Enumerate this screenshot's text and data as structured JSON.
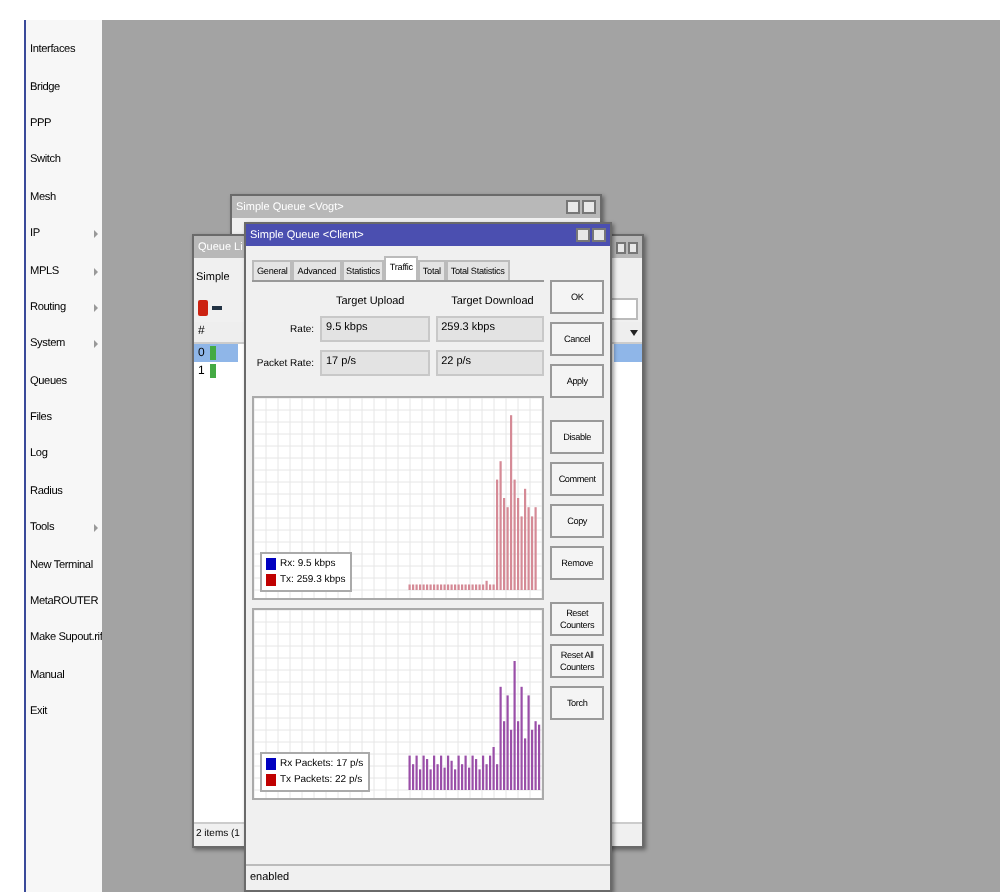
{
  "sidebar": {
    "items": [
      {
        "label": "Interfaces",
        "submenu": false
      },
      {
        "label": "Bridge",
        "submenu": false
      },
      {
        "label": "PPP",
        "submenu": false
      },
      {
        "label": "Switch",
        "submenu": false
      },
      {
        "label": "Mesh",
        "submenu": false
      },
      {
        "label": "IP",
        "submenu": true
      },
      {
        "label": "MPLS",
        "submenu": true
      },
      {
        "label": "Routing",
        "submenu": true
      },
      {
        "label": "System",
        "submenu": true
      },
      {
        "label": "Queues",
        "submenu": false
      },
      {
        "label": "Files",
        "submenu": false
      },
      {
        "label": "Log",
        "submenu": false
      },
      {
        "label": "Radius",
        "submenu": false
      },
      {
        "label": "Tools",
        "submenu": true
      },
      {
        "label": "New Terminal",
        "submenu": false
      },
      {
        "label": "MetaROUTER",
        "submenu": false
      },
      {
        "label": "Make Supout.rif",
        "submenu": false
      },
      {
        "label": "Manual",
        "submenu": false
      },
      {
        "label": "Exit",
        "submenu": false
      }
    ]
  },
  "back_window": {
    "title": "Simple Queue <Vogt>"
  },
  "list_window": {
    "title": "Queue Li",
    "tab": "Simple",
    "column": "#",
    "rows": [
      {
        "number": "0",
        "selected": true
      },
      {
        "number": "1",
        "selected": false
      }
    ],
    "status": "2 items (1"
  },
  "queue_window": {
    "title": "Simple Queue <Client>",
    "tabs": [
      {
        "label": "General",
        "selected": false
      },
      {
        "label": "Advanced",
        "selected": false
      },
      {
        "label": "Statistics",
        "selected": false
      },
      {
        "label": "Traffic",
        "selected": true
      },
      {
        "label": "Total",
        "selected": false
      },
      {
        "label": "Total Statistics",
        "selected": false
      }
    ],
    "columns": [
      "Target Upload",
      "Target Download"
    ],
    "fields": [
      {
        "label": "Rate:",
        "upload": "9.5 kbps",
        "download": "259.3 kbps"
      },
      {
        "label": "Packet Rate:",
        "upload": "17 p/s",
        "download": "22 p/s"
      }
    ],
    "graphs": [
      {
        "legend": [
          {
            "label": "Rx: 9.5 kbps",
            "color": "#0000c0"
          },
          {
            "label": "Tx: 259.3 kbps",
            "color": "#c00000"
          }
        ]
      },
      {
        "legend": [
          {
            "label": "Rx Packets: 17 p/s",
            "color": "#0000c0"
          },
          {
            "label": "Tx Packets: 22 p/s",
            "color": "#c00000"
          }
        ]
      }
    ],
    "button_groups": [
      [
        "OK",
        "Cancel",
        "Apply"
      ],
      [
        "Disable",
        "Comment",
        "Copy",
        "Remove"
      ],
      [
        "Reset Counters",
        "Reset All Counters",
        "Torch"
      ]
    ],
    "status": "enabled"
  }
}
